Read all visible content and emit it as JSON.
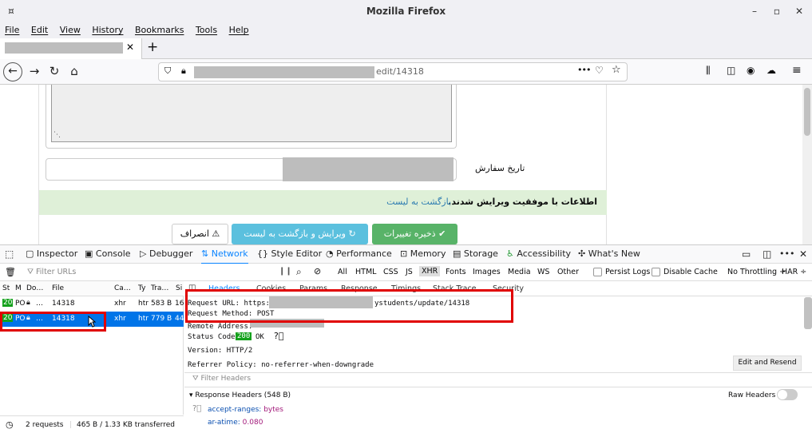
{
  "window": {
    "title": "Mozilla Firefox",
    "menu_glyph": "¤",
    "minimize": "–",
    "maximize": "▫",
    "close": "✕"
  },
  "menu": [
    "File",
    "Edit",
    "View",
    "History",
    "Bookmarks",
    "Tools",
    "Help"
  ],
  "tab": {
    "close": "✕",
    "new_tab": "+"
  },
  "nav": {
    "back": "←",
    "forward": "→",
    "reload": "↻",
    "home": "⌂",
    "url_suffix": "edit/14318",
    "more": "•••"
  },
  "page": {
    "order_date_label": "تاریخ سفارش",
    "success_message": "اطلاعات با موفقیت ویرایش شدند.",
    "back_to_list_link": "بازگشت به لیست",
    "save_button": "ذخیره تغییرات",
    "edit_back_button": "ویرایش و بازگشت به لیست",
    "cancel_button": "انصراف"
  },
  "devtools": {
    "tabs": [
      "Inspector",
      "Console",
      "Debugger",
      "Network",
      "Style Editor",
      "Performance",
      "Memory",
      "Storage",
      "Accessibility",
      "What's New"
    ],
    "filter_placeholder": "Filter URLs",
    "filter_types": [
      "All",
      "HTML",
      "CSS",
      "JS",
      "XHR",
      "Fonts",
      "Images",
      "Media",
      "WS",
      "Other"
    ],
    "persist_logs": "Persist Logs",
    "disable_cache": "Disable Cache",
    "throttling": "No Throttling ÷",
    "har": "HAR ÷",
    "columns": [
      "St",
      "M",
      "Do…",
      "File",
      "Ca…",
      "Ty",
      "Tra…",
      "Si"
    ],
    "requests": [
      {
        "status": "20",
        "method": "PO",
        "domain": "…",
        "file": "14318",
        "cause": "xhr",
        "type": "htr",
        "transferred": "583 B",
        "size": "16"
      },
      {
        "status": "20",
        "method": "PO",
        "domain": "…",
        "file": "14318",
        "cause": "xhr",
        "type": "htr",
        "transferred": "779 B",
        "size": "44"
      }
    ],
    "detail_tabs": [
      "Headers",
      "Cookies",
      "Params",
      "Response",
      "Timings",
      "Stack Trace",
      "Security"
    ],
    "request_url_label": "Request URL: https://",
    "request_url_suffix": "ystudents/update/14318",
    "request_method": "Request Method: POST",
    "remote_address": "Remote Address:",
    "status_code_label": "Status Code:",
    "status_code": "200",
    "status_text": "OK",
    "version": "Version: HTTP/2",
    "referrer_policy": "Referrer Policy: no-referrer-when-downgrade",
    "edit_resend": "Edit and Resend",
    "filter_headers": "Filter Headers",
    "response_headers": "Response Headers (548 B)",
    "raw_headers": "Raw Headers",
    "headers": [
      {
        "name": "accept-ranges",
        "value": "bytes"
      },
      {
        "name": "ar-atime",
        "value": "0.080"
      }
    ],
    "summary_requests": "2 requests",
    "summary_transferred": "465 B / 1.33 KB transferred"
  },
  "colors": {
    "accent": "#0a84ff",
    "success": "#58b368",
    "info": "#5bc0de",
    "highlight": "#e00000",
    "status_ok": "#14a11c"
  }
}
